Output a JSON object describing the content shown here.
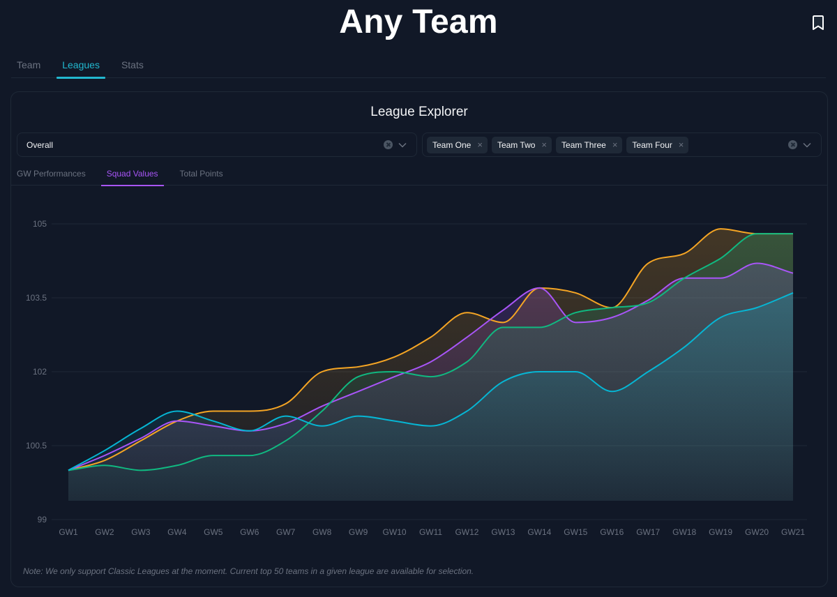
{
  "header": {
    "title": "Any Team",
    "bookmark_icon": "bookmark-icon"
  },
  "main_tabs": [
    {
      "label": "Team",
      "active": false
    },
    {
      "label": "Leagues",
      "active": true
    },
    {
      "label": "Stats",
      "active": false
    }
  ],
  "card": {
    "title": "League Explorer",
    "league_select": {
      "value": "Overall"
    },
    "teams_select": {
      "chips": [
        "Team One",
        "Team Two",
        "Team Three",
        "Team Four"
      ],
      "chip_remove_glyph": "×"
    },
    "sub_tabs": [
      {
        "label": "GW Performances",
        "active": false
      },
      {
        "label": "Squad Values",
        "active": true
      },
      {
        "label": "Total Points",
        "active": false
      }
    ],
    "note": "Note: We only support Classic Leagues at the moment. Current top 50 teams in a given league are available for selection."
  },
  "colors": {
    "background": "#111827",
    "accent_main": "#22b8cf",
    "accent_sub": "#a855f7",
    "series_orange": "#f5a524",
    "series_purple": "#a855f7",
    "series_green": "#10b981",
    "series_cyan": "#06b6d4"
  },
  "chart_data": {
    "type": "area",
    "title": "",
    "xlabel": "",
    "ylabel": "",
    "categories": [
      "GW1",
      "GW2",
      "GW3",
      "GW4",
      "GW5",
      "GW6",
      "GW7",
      "GW8",
      "GW9",
      "GW10",
      "GW11",
      "GW12",
      "GW13",
      "GW14",
      "GW15",
      "GW16",
      "GW17",
      "GW18",
      "GW19",
      "GW20",
      "GW21"
    ],
    "y_ticks": [
      99,
      100.5,
      102,
      103.5,
      105
    ],
    "ylim": [
      99,
      105
    ],
    "grid": true,
    "legend": "none",
    "series": [
      {
        "name": "orange",
        "color": "#f5a524",
        "values": [
          100.0,
          100.2,
          100.6,
          101.0,
          101.2,
          101.2,
          101.35,
          102.0,
          102.1,
          102.3,
          102.7,
          103.2,
          103.0,
          103.7,
          103.6,
          103.3,
          104.2,
          104.4,
          104.9,
          104.8,
          104.8
        ]
      },
      {
        "name": "purple",
        "color": "#a855f7",
        "values": [
          100.0,
          100.3,
          100.65,
          101.0,
          100.9,
          100.8,
          100.95,
          101.3,
          101.6,
          101.9,
          102.2,
          102.7,
          103.25,
          103.7,
          103.0,
          103.1,
          103.45,
          103.9,
          103.9,
          104.2,
          104.0
        ]
      },
      {
        "name": "green",
        "color": "#10b981",
        "values": [
          100.0,
          100.1,
          100.0,
          100.1,
          100.3,
          100.3,
          100.6,
          101.2,
          101.9,
          102.0,
          101.9,
          102.2,
          102.9,
          102.9,
          103.2,
          103.3,
          103.4,
          103.9,
          104.3,
          104.8,
          104.8
        ]
      },
      {
        "name": "cyan",
        "color": "#06b6d4",
        "values": [
          100.0,
          100.4,
          100.85,
          101.2,
          101.0,
          100.8,
          101.1,
          100.9,
          101.1,
          101.0,
          100.9,
          101.2,
          101.8,
          102.0,
          102.0,
          101.6,
          102.0,
          102.5,
          103.1,
          103.3,
          103.6
        ]
      }
    ]
  }
}
